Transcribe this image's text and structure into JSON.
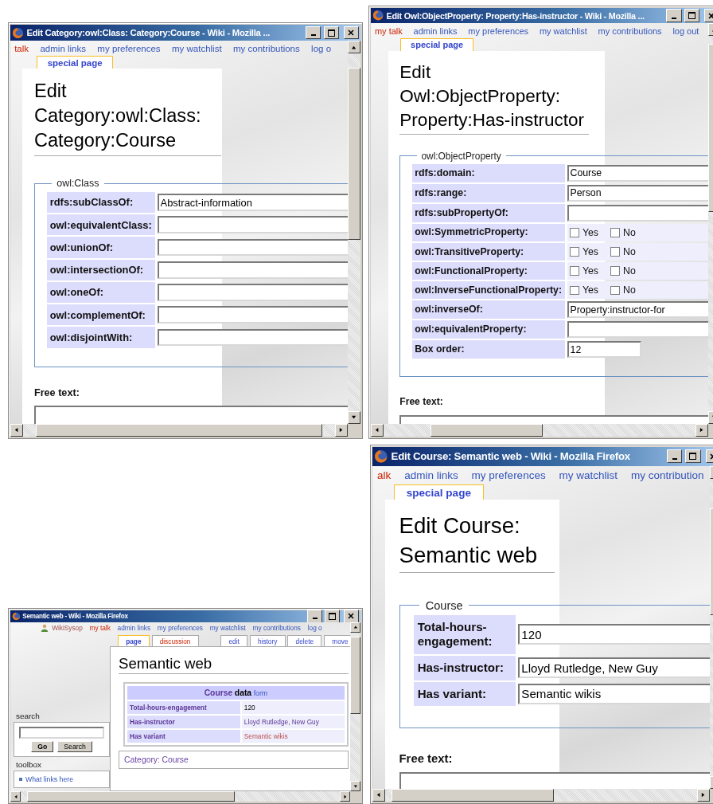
{
  "windows": [
    {
      "kind": "edit_form",
      "title": "Edit Category:owl:Class: Category:Course - Wiki - Mozilla ...",
      "nav_links": [
        {
          "label": "talk",
          "missing": true
        },
        {
          "label": "admin links",
          "missing": false
        },
        {
          "label": "my preferences",
          "missing": false
        },
        {
          "label": "my watchlist",
          "missing": false
        },
        {
          "label": "my contributions",
          "missing": false
        },
        {
          "label": "log o",
          "missing": false
        }
      ],
      "tabs": [
        {
          "label": "special page",
          "selected": true,
          "missing": false
        }
      ],
      "heading": "Edit Category:owl:Class: Category:Course",
      "fieldset": {
        "legend": "owl:Class",
        "rows": [
          {
            "kind": "text",
            "label": "rdfs:subClassOf:",
            "value": "Abstract-information"
          },
          {
            "kind": "text",
            "label": "owl:equivalentClass:"
          },
          {
            "kind": "text",
            "label": "owl:unionOf:"
          },
          {
            "kind": "text",
            "label": "owl:intersectionOf:"
          },
          {
            "kind": "text",
            "label": "owl:oneOf:"
          },
          {
            "kind": "text",
            "label": "owl:complementOf:"
          },
          {
            "kind": "text",
            "label": "owl:disjointWith:"
          }
        ]
      },
      "free_text_label": "Free text:"
    },
    {
      "kind": "edit_form",
      "title": "Edit Owl:ObjectProperty: Property:Has-instructor - Wiki - Mozilla ...",
      "nav_links": [
        {
          "label": "my talk",
          "missing": true
        },
        {
          "label": "admin links",
          "missing": false
        },
        {
          "label": "my preferences",
          "missing": false
        },
        {
          "label": "my watchlist",
          "missing": false
        },
        {
          "label": "my contributions",
          "missing": false
        },
        {
          "label": "log out",
          "missing": false
        }
      ],
      "tabs": [
        {
          "label": "special page",
          "selected": true,
          "missing": false
        }
      ],
      "heading": "Edit Owl:ObjectProperty: Property:Has-instructor",
      "fieldset": {
        "legend": "owl:ObjectProperty",
        "rows": [
          {
            "kind": "text",
            "label": "rdfs:domain:",
            "value": "Course"
          },
          {
            "kind": "text",
            "label": "rdfs:range:",
            "value": "Person"
          },
          {
            "kind": "text",
            "label": "rdfs:subPropertyOf:"
          },
          {
            "kind": "checkboxes",
            "label": "owl:SymmetricProperty:",
            "options": [
              {
                "label": "Yes",
                "checked": false
              },
              {
                "label": "No",
                "checked": false
              }
            ]
          },
          {
            "kind": "checkboxes",
            "label": "owl:TransitiveProperty:",
            "options": [
              {
                "label": "Yes",
                "checked": false
              },
              {
                "label": "No",
                "checked": false
              }
            ]
          },
          {
            "kind": "checkboxes",
            "label": "owl:FunctionalProperty:",
            "options": [
              {
                "label": "Yes",
                "checked": false
              },
              {
                "label": "No",
                "checked": false
              }
            ]
          },
          {
            "kind": "checkboxes",
            "label": "owl:InverseFunctionalProperty:",
            "options": [
              {
                "label": "Yes",
                "checked": false
              },
              {
                "label": "No",
                "checked": false
              }
            ]
          },
          {
            "kind": "text",
            "label": "owl:inverseOf:",
            "value": "Property:instructor-for"
          },
          {
            "kind": "text",
            "label": "owl:equivalentProperty:"
          },
          {
            "kind": "short_text",
            "label": "Box order:",
            "value": "12"
          }
        ]
      },
      "free_text_label": "Free text:"
    },
    {
      "kind": "edit_form",
      "title": "Edit Course: Semantic web - Wiki - Mozilla Firefox",
      "nav_links": [
        {
          "label": "alk",
          "missing": true
        },
        {
          "label": "admin links",
          "missing": false
        },
        {
          "label": "my preferences",
          "missing": false
        },
        {
          "label": "my watchlist",
          "missing": false
        },
        {
          "label": "my contribution",
          "missing": false
        }
      ],
      "tabs": [
        {
          "label": "special page",
          "selected": true,
          "missing": false
        }
      ],
      "heading": "Edit Course: Semantic web",
      "fieldset": {
        "legend": "Course",
        "rows": [
          {
            "kind": "text",
            "label": "Total-hours-engagement:",
            "value": "120"
          },
          {
            "kind": "text",
            "label": "Has-instructor:",
            "value": "Lloyd Rutledge, New Guy"
          },
          {
            "kind": "text",
            "label": "Has variant:",
            "value": "Semantic wikis"
          }
        ]
      },
      "free_text_label": "Free text:"
    },
    {
      "kind": "article",
      "title": "Semantic web - Wiki - Mozilla Firefox",
      "user": "WikiSysop",
      "nav_links": [
        {
          "label": "my talk",
          "missing": true
        },
        {
          "label": "admin links",
          "missing": false
        },
        {
          "label": "my preferences",
          "missing": false
        },
        {
          "label": "my watchlist",
          "missing": false
        },
        {
          "label": "my contributions",
          "missing": false
        },
        {
          "label": "log o",
          "missing": false
        }
      ],
      "tabs": [
        {
          "label": "page",
          "selected": true,
          "missing": false
        },
        {
          "label": "discussion",
          "selected": false,
          "missing": true
        },
        {
          "label": "edit",
          "selected": false,
          "missing": false
        },
        {
          "label": "history",
          "selected": false,
          "missing": false
        },
        {
          "label": "delete",
          "selected": false,
          "missing": false
        },
        {
          "label": "move",
          "selected": false,
          "missing": false
        }
      ],
      "heading": "Semantic web",
      "infobox": {
        "title_link": "Course",
        "title_rest": "data",
        "form_link": "form",
        "rows": [
          {
            "label": "Total-hours-engagement",
            "value": "120",
            "link": false,
            "missing": false
          },
          {
            "label": "Has-instructor",
            "value": "Lloyd Rutledge, New Guy",
            "link": true,
            "missing": false
          },
          {
            "label": "Has variant",
            "value": "Semantic wikis",
            "link": true,
            "missing": true
          }
        ]
      },
      "category_label": "Category:",
      "category": "Course",
      "sidebar": {
        "search_label": "search",
        "buttons": [
          "Go",
          "Search"
        ],
        "toolbox_label": "toolbox",
        "toolbox_links": [
          "What links here"
        ]
      }
    }
  ]
}
